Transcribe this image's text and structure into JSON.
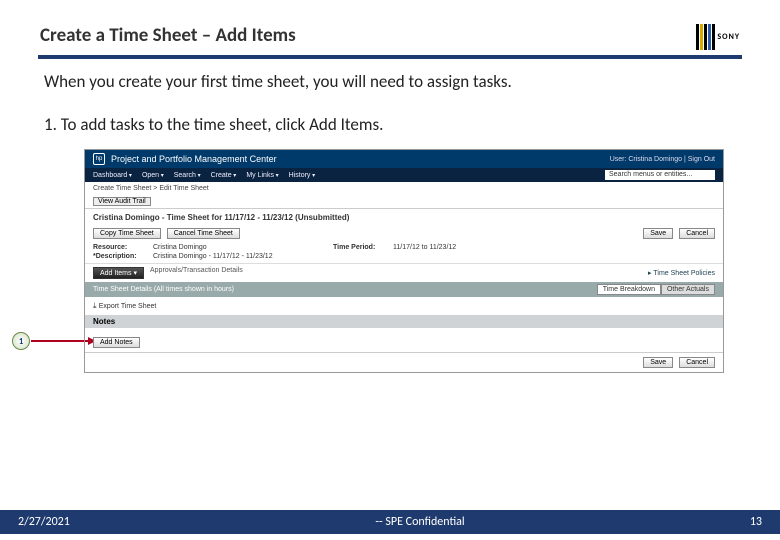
{
  "header": {
    "title": "Create a Time Sheet – Add Items",
    "logo_text": "SONY"
  },
  "intro": "When you create your first time sheet, you will need to assign tasks.",
  "step": "1.  To add tasks to the time sheet, click Add Items.",
  "callout_num": "1",
  "app": {
    "title": "Project and Portfolio Management Center",
    "user": "User: Cristina Domingo | Sign Out",
    "menu": [
      "Dashboard",
      "Open",
      "Search",
      "Create",
      "My Links",
      "History"
    ],
    "search_placeholder": "Search menus or entities...",
    "breadcrumb": "Create Time Sheet > Edit Time Sheet",
    "view_last": "View Audit Trail",
    "sheet_title": "Cristina Domingo - Time Sheet for 11/17/12 - 11/23/12 (Unsubmitted)",
    "btn_copy": "Copy Time Sheet",
    "btn_cancel_ts": "Cancel Time Sheet",
    "btn_save": "Save",
    "btn_cancel": "Cancel",
    "form": {
      "resource_lbl": "Resource:",
      "resource_val": "Cristina Domingo",
      "period_lbl": "Time Period:",
      "period_val": "11/17/12 to 11/23/12",
      "desc_lbl": "*Description:",
      "desc_val": "Cristina Domingo - 11/17/12 - 11/23/12"
    },
    "btn_add_items": "Add Items ▾",
    "approval": "Approvals/Transaction Details",
    "policies": "Time Sheet Policies",
    "details_bar": "Time Sheet Details (All times shown in hours)",
    "tab1": "Time Breakdown",
    "tab2": "Other Actuals",
    "export": "Export Time Sheet",
    "notes_hdr": "Notes",
    "btn_add_notes": "Add Notes"
  },
  "footer": {
    "date": "2/27/2021",
    "conf": "-- SPE Confidential",
    "page": "13"
  }
}
